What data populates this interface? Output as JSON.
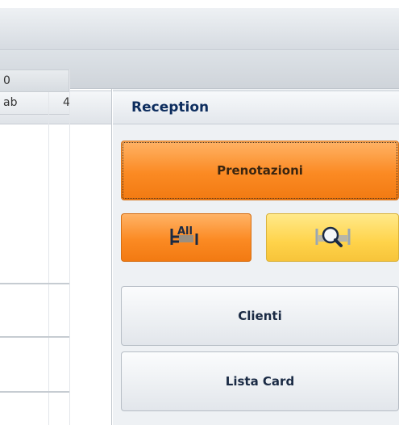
{
  "left_grid": {
    "header_cell": "0",
    "row": [
      "ab",
      "4"
    ]
  },
  "reception": {
    "title": "Reception",
    "buttons": {
      "prenotazioni": "Prenotazioni",
      "all_icon_text": "All",
      "clienti": "Clienti",
      "lista_card": "Lista Card"
    }
  },
  "icons": {
    "all": "all-bookings-icon",
    "search": "search-booking-icon"
  },
  "colors": {
    "orange": "#fb8a23",
    "yellow": "#ffd34a",
    "title": "#0d2d5e"
  }
}
